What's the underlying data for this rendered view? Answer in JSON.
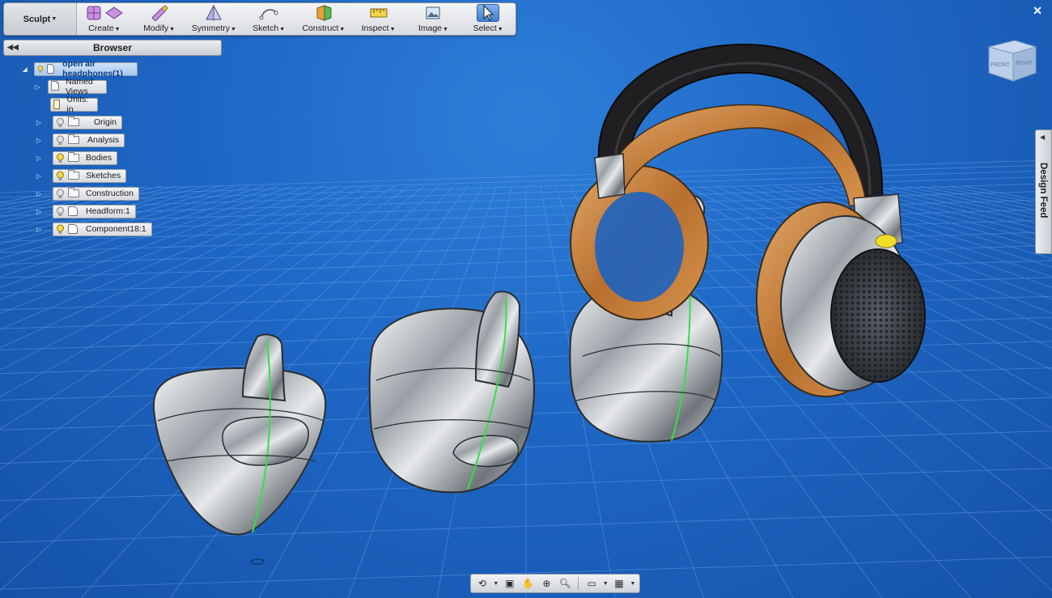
{
  "toolbar": {
    "workspace": "Sculpt",
    "groups": [
      {
        "label": "Create",
        "icon": "box-plane-icon"
      },
      {
        "label": "Modify",
        "icon": "modify-brush-icon"
      },
      {
        "label": "Symmetry",
        "icon": "symmetry-icon"
      },
      {
        "label": "Sketch",
        "icon": "sketch-arc-icon"
      },
      {
        "label": "Construct",
        "icon": "construct-plane-icon"
      },
      {
        "label": "Inspect",
        "icon": "ruler-icon"
      },
      {
        "label": "Image",
        "icon": "picture-icon"
      },
      {
        "label": "Select",
        "icon": "cursor-arrow-icon"
      }
    ]
  },
  "browser": {
    "title": "Browser",
    "root": "open air headphones(1)",
    "items": [
      {
        "label": "Named Views",
        "kind": "folder"
      },
      {
        "label": "Units: in",
        "kind": "doc"
      },
      {
        "label": "Origin",
        "kind": "folder"
      },
      {
        "label": "Analysis",
        "kind": "folder"
      },
      {
        "label": "Bodies",
        "kind": "folder"
      },
      {
        "label": "Sketches",
        "kind": "folder"
      },
      {
        "label": "Construction",
        "kind": "folder"
      },
      {
        "label": "Headform:1",
        "kind": "component"
      },
      {
        "label": "Component18:1",
        "kind": "component"
      }
    ]
  },
  "viewcube": {
    "front": "FRONT",
    "right": "RIGHT"
  },
  "design_feed": {
    "label": "Design Feed"
  },
  "colors": {
    "viewport_blue": "#1e66c4",
    "grid_line": "#5e9be6",
    "wood": "#c9823f",
    "band_dark": "#1f1f22",
    "chrome": "#c8ccd2"
  }
}
